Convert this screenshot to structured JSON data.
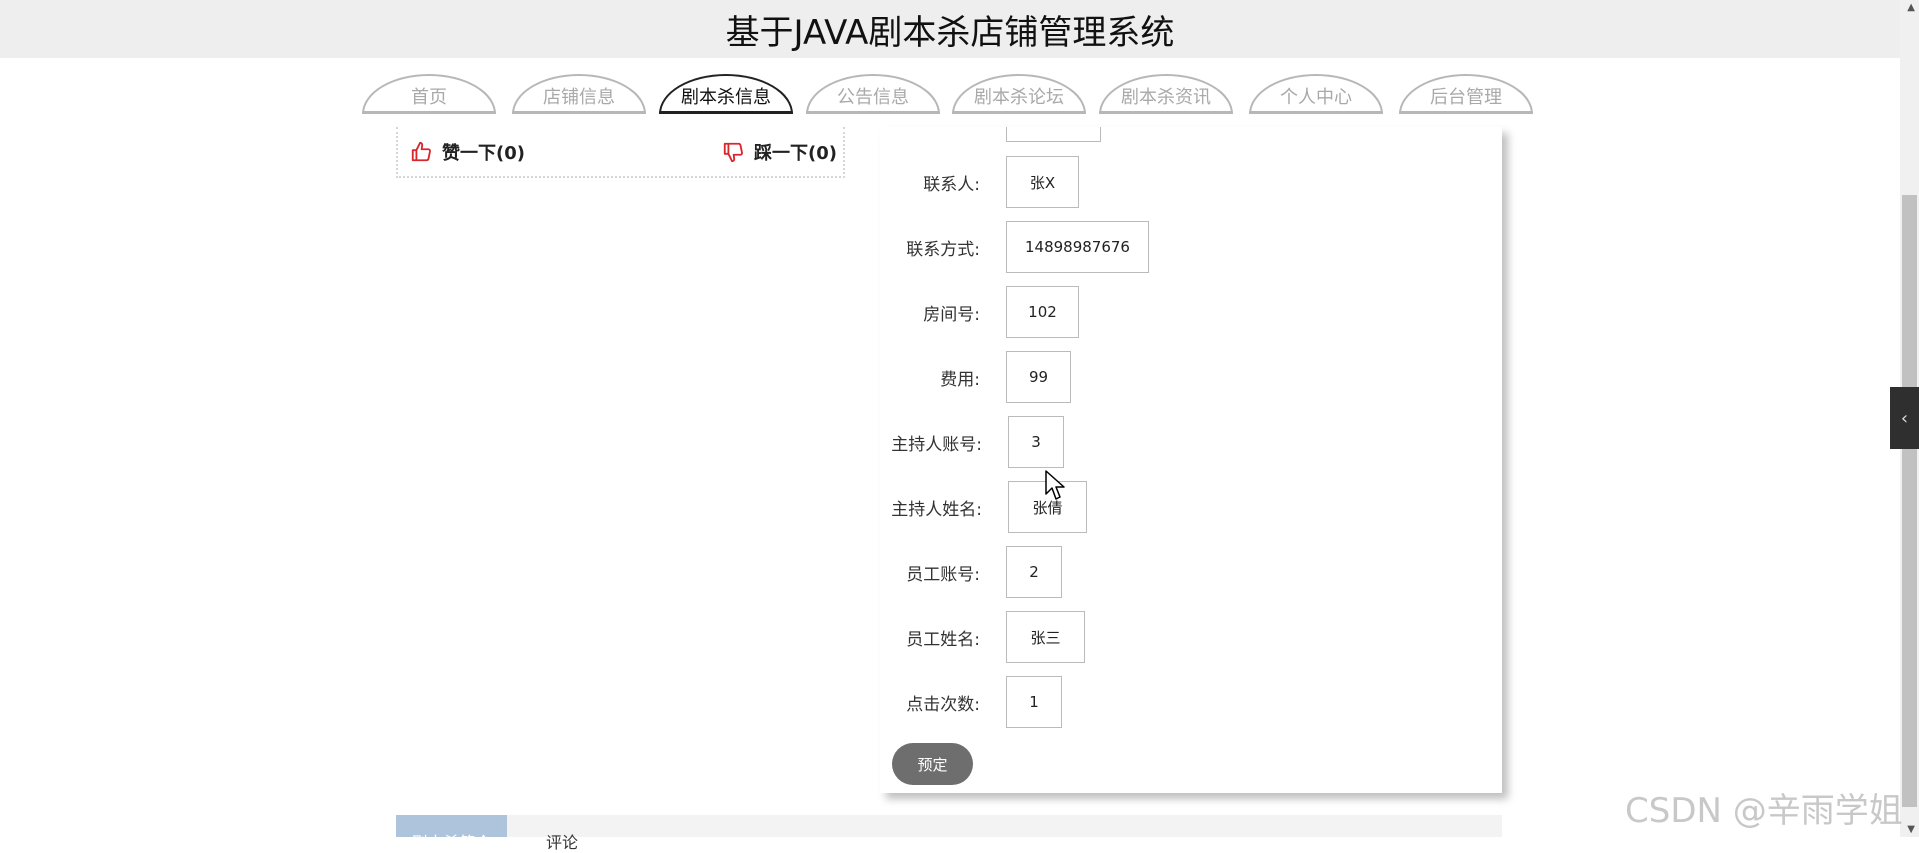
{
  "app": {
    "title": "基于JAVA剧本杀店铺管理系统"
  },
  "nav": {
    "tabs": [
      {
        "label": "首页",
        "active": false
      },
      {
        "label": "店铺信息",
        "active": false
      },
      {
        "label": "剧本杀信息",
        "active": true
      },
      {
        "label": "公告信息",
        "active": false
      },
      {
        "label": "剧本杀论坛",
        "active": false
      },
      {
        "label": "剧本杀资讯",
        "active": false
      },
      {
        "label": "个人中心",
        "active": false
      },
      {
        "label": "后台管理",
        "active": false
      }
    ]
  },
  "votes": {
    "like_label": "赞一下(0)",
    "dislike_label": "踩一下(0)",
    "like_icon": "thumbs-up-icon",
    "dislike_icon": "thumbs-down-icon",
    "icon_color": "#d9262c"
  },
  "details": {
    "fields": [
      {
        "label": "联系人:",
        "value": "张X"
      },
      {
        "label": "联系方式:",
        "value": "14898987676"
      },
      {
        "label": "房间号:",
        "value": "102"
      },
      {
        "label": "费用:",
        "value": "99"
      },
      {
        "label": "主持人账号:",
        "value": "3"
      },
      {
        "label": "主持人姓名:",
        "value": "张倩"
      },
      {
        "label": "员工账号:",
        "value": "2"
      },
      {
        "label": "员工姓名:",
        "value": "张三"
      },
      {
        "label": "点击次数:",
        "value": "1"
      }
    ],
    "book_button": "预定"
  },
  "bottom_tabs": [
    {
      "label": "剧本杀简介",
      "active": true
    },
    {
      "label": "评论",
      "active": false
    }
  ],
  "side_handle": {
    "icon": "chevron-left-icon",
    "glyph": "‹"
  },
  "watermark": "CSDN @辛雨学姐"
}
